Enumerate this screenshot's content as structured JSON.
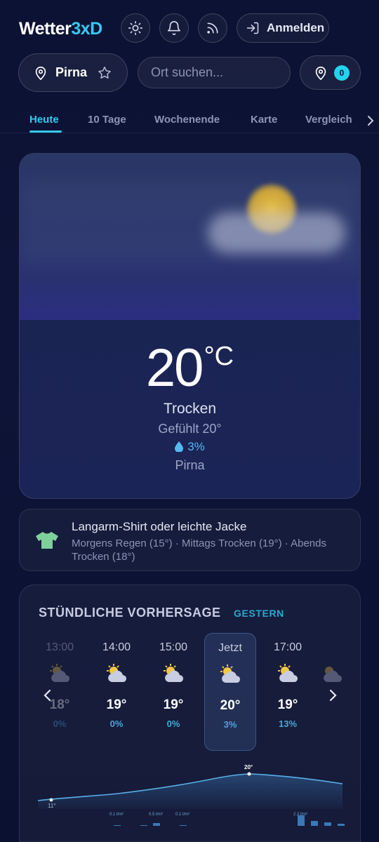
{
  "header": {
    "brand_main": "Wetter",
    "brand_accent": "3xD",
    "login_label": "Anmelden"
  },
  "location": {
    "name": "Pirna",
    "search_placeholder": "Ort suchen...",
    "favorites_count": "0"
  },
  "tabs": [
    {
      "label": "Heute",
      "active": true
    },
    {
      "label": "10 Tage"
    },
    {
      "label": "Wochenende"
    },
    {
      "label": "Karte"
    },
    {
      "label": "Vergleich"
    }
  ],
  "current": {
    "temperature": "20",
    "unit": "°C",
    "condition": "Trocken",
    "feels_like": "Gefühlt 20°",
    "rain_chance": "3%",
    "place": "Pirna"
  },
  "clothing": {
    "title": "Langarm-Shirt oder leichte Jacke",
    "detail": "Morgens Regen (15°) · Mittags Trocken (19°) · Abends Trocken (18°)"
  },
  "hourly": {
    "title": "STÜNDLICHE VORHERSAGE",
    "link": "GESTERN",
    "hours": [
      {
        "time": "13:00",
        "temp": "18°",
        "precip": "0%",
        "icon": "sun-cloud-icon"
      },
      {
        "time": "14:00",
        "temp": "19°",
        "precip": "0%",
        "icon": "sun-cloud-icon"
      },
      {
        "time": "15:00",
        "temp": "19°",
        "precip": "0%",
        "icon": "sun-cloud-icon"
      },
      {
        "time": "Jetzt",
        "temp": "20°",
        "precip": "3%",
        "icon": "sun-cloud-icon"
      },
      {
        "time": "17:00",
        "temp": "19°",
        "precip": "13%",
        "icon": "sun-cloud-icon"
      }
    ],
    "chart": {
      "min_label": "11°",
      "max_label": "20°",
      "rain_labels": [
        "0.1 l/m²",
        "0.5 l/m²",
        "0.1 l/m²",
        "2.3 l/m²"
      ]
    }
  },
  "colors": {
    "accent": "#35c9f0",
    "background": "#0c1233",
    "rain": "#4aa6dc"
  }
}
